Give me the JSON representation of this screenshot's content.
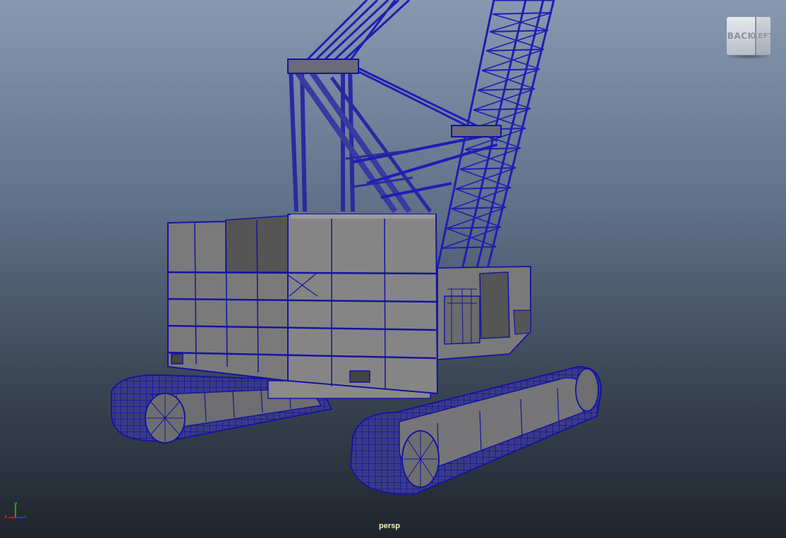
{
  "viewport": {
    "camera_name": "persp",
    "background_top": "#8799b0",
    "background_bottom": "#1f252d"
  },
  "view_cube": {
    "back_label": "BACK",
    "left_label": "LEFT",
    "icon": "view-cube-icon"
  },
  "axis_gizmo": {
    "x_label": "x",
    "y_label": "y",
    "z_label": "z",
    "x_color": "#e02020",
    "y_color": "#20d020",
    "z_color": "#2040ff"
  },
  "scene": {
    "object": "crawler-crane-model",
    "display_mode": "wireframe-on-shaded",
    "wire_color": "#1a1aa0",
    "shade_color": "#7a7a7a"
  }
}
